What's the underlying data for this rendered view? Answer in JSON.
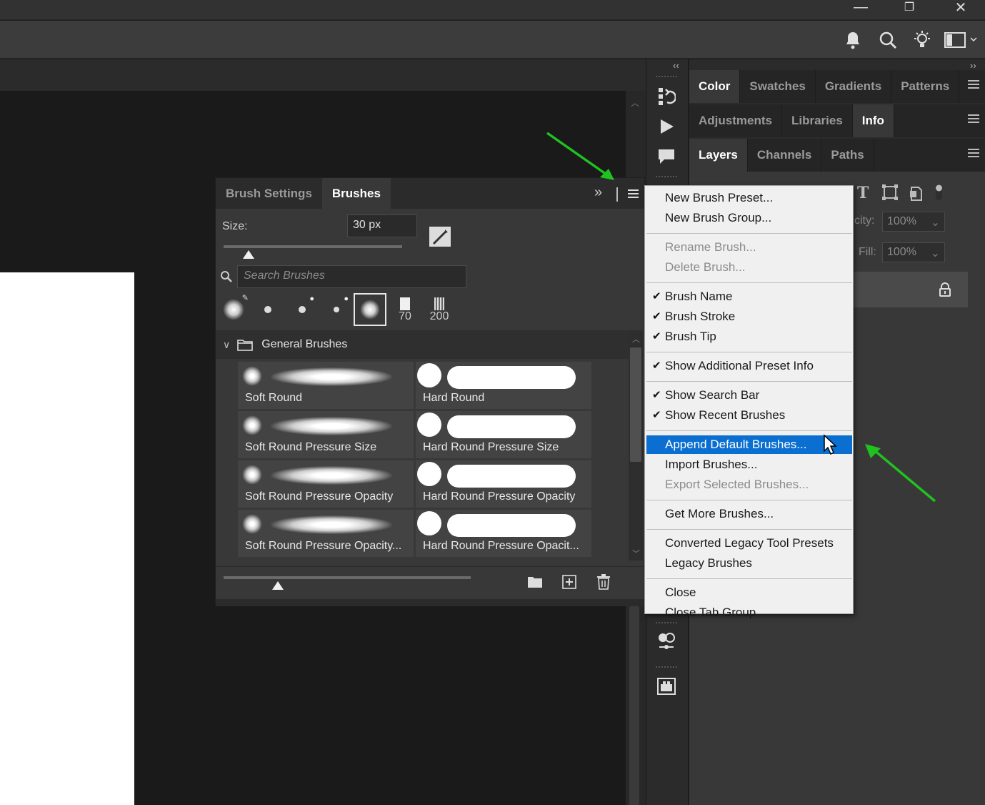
{
  "window": {
    "minimize_glyph": "—",
    "restore_glyph": "❐",
    "close_glyph": "✕"
  },
  "topbar_icons": [
    "bell-icon",
    "search-icon",
    "lightbulb-icon",
    "workspace-icon"
  ],
  "right_panels": {
    "row1": {
      "tabs": [
        "Color",
        "Swatches",
        "Gradients",
        "Patterns"
      ],
      "active": "Color"
    },
    "row2": {
      "tabs": [
        "Adjustments",
        "Libraries",
        "Info"
      ],
      "active": "Info"
    },
    "row3": {
      "tabs": [
        "Layers",
        "Channels",
        "Paths"
      ],
      "active": "Layers"
    },
    "opacity_label": "city:",
    "opacity_value": "100%",
    "fill_label": "Fill:",
    "fill_value": "100%"
  },
  "brush_panel": {
    "tabs": [
      "Brush Settings",
      "Brushes"
    ],
    "active_tab": "Brushes",
    "collapse_glyph": "»",
    "size_label": "Size:",
    "size_value": "30 px",
    "size_slider_fraction": 0.14,
    "search_placeholder": "Search Brushes",
    "recent": [
      {
        "kind": "soft",
        "label": ""
      },
      {
        "kind": "small",
        "label": ""
      },
      {
        "kind": "small",
        "label": ""
      },
      {
        "kind": "small",
        "label": ""
      },
      {
        "kind": "soft-selected",
        "label": ""
      },
      {
        "kind": "square",
        "label": "70"
      },
      {
        "kind": "texture",
        "label": "200"
      }
    ],
    "group_name": "General Brushes",
    "brushes": [
      {
        "name": "Soft Round",
        "type": "soft"
      },
      {
        "name": "Hard Round",
        "type": "hard"
      },
      {
        "name": "Soft Round Pressure Size",
        "type": "soft"
      },
      {
        "name": "Hard Round Pressure Size",
        "type": "hard"
      },
      {
        "name": "Soft Round Pressure Opacity",
        "type": "soft"
      },
      {
        "name": "Hard Round Pressure Opacity",
        "type": "hard"
      },
      {
        "name": "Soft Round Pressure Opacity...",
        "type": "soft"
      },
      {
        "name": "Hard Round Pressure Opacit...",
        "type": "hard"
      }
    ],
    "preview_slider_fraction": 0.22
  },
  "flyout_menu": {
    "items": [
      {
        "label": "New Brush Preset...",
        "checked": false,
        "disabled": false,
        "highlight": false
      },
      {
        "label": "New Brush Group...",
        "checked": false,
        "disabled": false,
        "highlight": false
      },
      {
        "sep": true
      },
      {
        "label": "Rename Brush...",
        "checked": false,
        "disabled": true,
        "highlight": false
      },
      {
        "label": "Delete Brush...",
        "checked": false,
        "disabled": true,
        "highlight": false
      },
      {
        "sep": true
      },
      {
        "label": "Brush Name",
        "checked": true,
        "disabled": false,
        "highlight": false
      },
      {
        "label": "Brush Stroke",
        "checked": true,
        "disabled": false,
        "highlight": false
      },
      {
        "label": "Brush Tip",
        "checked": true,
        "disabled": false,
        "highlight": false
      },
      {
        "sep": true
      },
      {
        "label": "Show Additional Preset Info",
        "checked": true,
        "disabled": false,
        "highlight": false
      },
      {
        "sep": true
      },
      {
        "label": "Show Search Bar",
        "checked": true,
        "disabled": false,
        "highlight": false
      },
      {
        "label": "Show Recent Brushes",
        "checked": true,
        "disabled": false,
        "highlight": false
      },
      {
        "sep": true
      },
      {
        "label": "Append Default Brushes...",
        "checked": false,
        "disabled": false,
        "highlight": true
      },
      {
        "label": "Import Brushes...",
        "checked": false,
        "disabled": false,
        "highlight": false
      },
      {
        "label": "Export Selected Brushes...",
        "checked": false,
        "disabled": true,
        "highlight": false
      },
      {
        "sep": true
      },
      {
        "label": "Get More Brushes...",
        "checked": false,
        "disabled": false,
        "highlight": false
      },
      {
        "sep": true
      },
      {
        "label": "Converted Legacy Tool Presets",
        "checked": false,
        "disabled": false,
        "highlight": false
      },
      {
        "label": "Legacy Brushes",
        "checked": false,
        "disabled": false,
        "highlight": false
      },
      {
        "sep": true
      },
      {
        "label": "Close",
        "checked": false,
        "disabled": false,
        "highlight": false
      },
      {
        "label": "Close Tab Group",
        "checked": false,
        "disabled": false,
        "highlight": false
      }
    ]
  },
  "colors": {
    "highlight": "#0a6fd1",
    "annotation_arrow": "#1fc21f"
  }
}
